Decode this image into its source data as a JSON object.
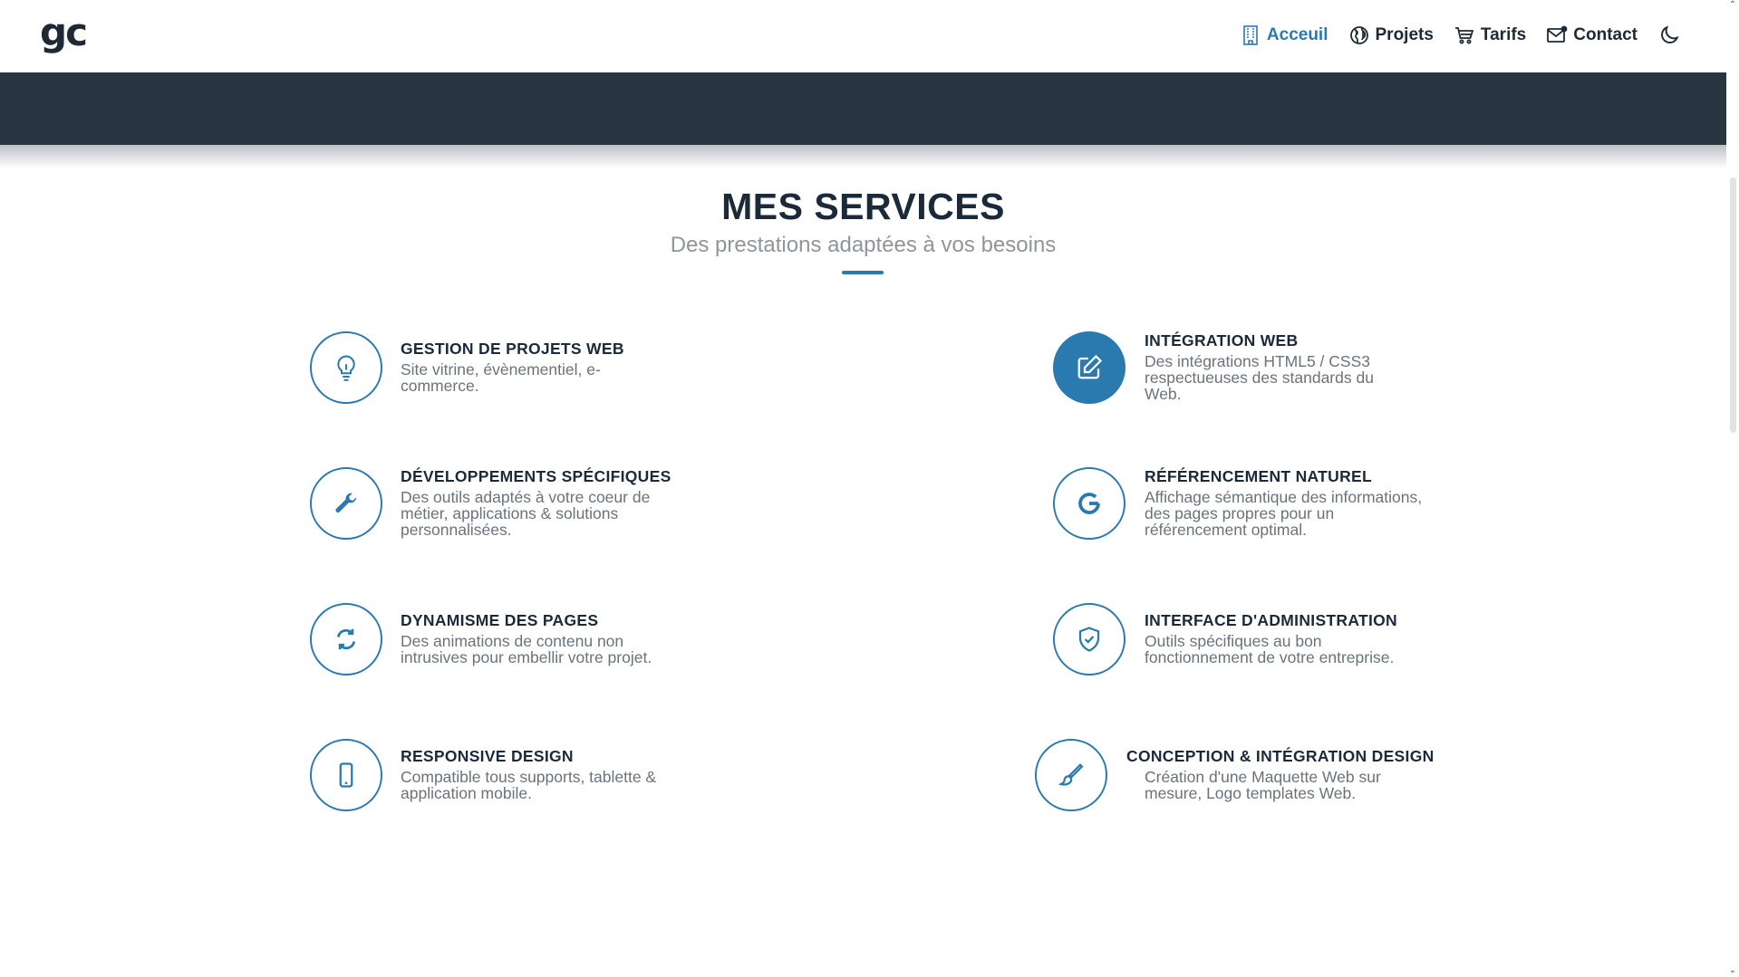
{
  "header": {
    "logo": "gc",
    "nav": [
      {
        "label": "Acceuil",
        "icon": "building-icon",
        "active": true
      },
      {
        "label": "Projets",
        "icon": "globe-icon",
        "active": false
      },
      {
        "label": "Tarifs",
        "icon": "cart-icon",
        "active": false
      },
      {
        "label": "Contact",
        "icon": "envelope-icon",
        "active": false
      }
    ],
    "theme_toggle_icon": "moon-icon"
  },
  "section": {
    "title": "MES SERVICES",
    "subtitle": "Des prestations adaptées à vos besoins"
  },
  "services": [
    {
      "title": "GESTION DE PROJETS WEB",
      "desc": "Site vitrine, évènementiel, e-commerce.",
      "icon": "lightbulb-icon"
    },
    {
      "title": "INTÉGRATION WEB",
      "desc": "Des intégrations HTML5 / CSS3 respectueuses des standards du Web.",
      "icon": "edit-icon",
      "highlighted": true
    },
    {
      "title": "DÉVELOPPEMENTS SPÉCIFIQUES",
      "desc": "Des outils adaptés à votre coeur de métier, applications & solutions personnalisées.",
      "icon": "wrench-icon"
    },
    {
      "title": "RÉFÉRENCEMENT NATUREL",
      "desc": "Affichage sémantique des informations, des pages propres pour un référencement optimal.",
      "icon": "google-icon"
    },
    {
      "title": "DYNAMISME DES PAGES",
      "desc": "Des animations de contenu non intrusives pour embellir votre projet.",
      "icon": "refresh-icon"
    },
    {
      "title": "INTERFACE D'ADMINISTRATION",
      "desc": "Outils spécifiques au bon fonctionnement de votre entreprise.",
      "icon": "shield-check-icon"
    },
    {
      "title": "RESPONSIVE DESIGN",
      "desc": "Compatible tous supports, tablette & application mobile.",
      "icon": "smartphone-icon"
    },
    {
      "title": "CONCEPTION & INTÉGRATION DESIGN",
      "desc": "Création d'une Maquette Web sur mesure, Logo templates Web.",
      "icon": "brush-icon"
    }
  ],
  "colors": {
    "accent": "#2a7ab0",
    "dark_band": "#28343f",
    "title": "#1b2a3a",
    "muted": "#6a737b"
  }
}
